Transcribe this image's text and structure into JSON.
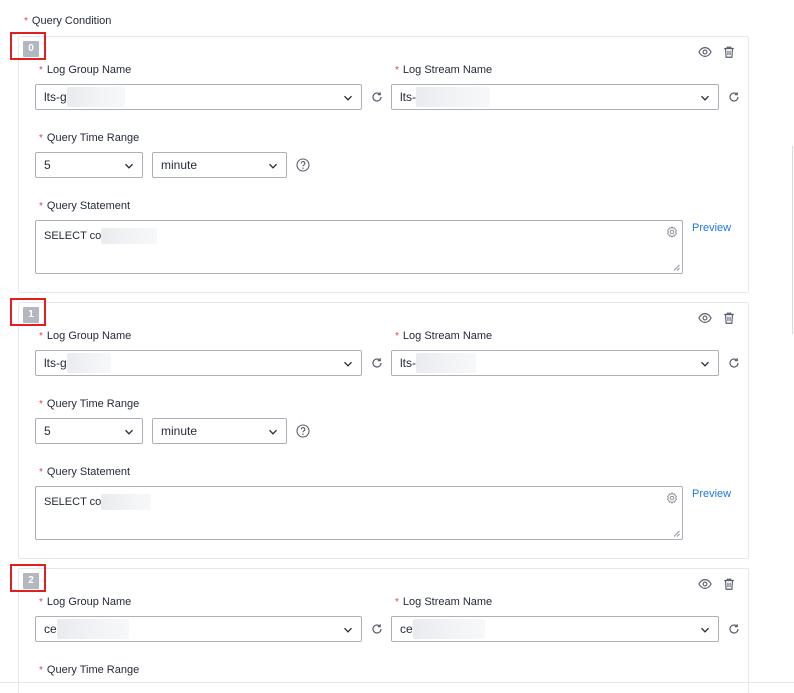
{
  "section": {
    "label": "Query Condition",
    "required_mark": "*"
  },
  "labels": {
    "log_group": "Log Group Name",
    "log_stream": "Log Stream Name",
    "time_range": "Query Time Range",
    "statement": "Query Statement",
    "preview": "Preview"
  },
  "conditions": [
    {
      "index": "0",
      "log_group_value": "lts-g",
      "log_stream_value": "lts-",
      "time_value": "5",
      "time_unit": "minute",
      "statement": "SELECT co"
    },
    {
      "index": "1",
      "log_group_value": "lts-g",
      "log_stream_value": "lts-",
      "time_value": "5",
      "time_unit": "minute",
      "statement": "SELECT co"
    },
    {
      "index": "2",
      "log_group_value": "ce",
      "log_stream_value": "ce"
    }
  ],
  "icons": {
    "visibility": "eye-icon",
    "delete": "trash-icon",
    "dropdown": "chevron-down-icon",
    "refresh": "refresh-icon",
    "help": "question-circle-icon",
    "settings": "gear-icon"
  },
  "colors": {
    "required": "#e54545",
    "link": "#1e79e0",
    "highlight": "#e02020",
    "badge": "#b3b7bf"
  }
}
